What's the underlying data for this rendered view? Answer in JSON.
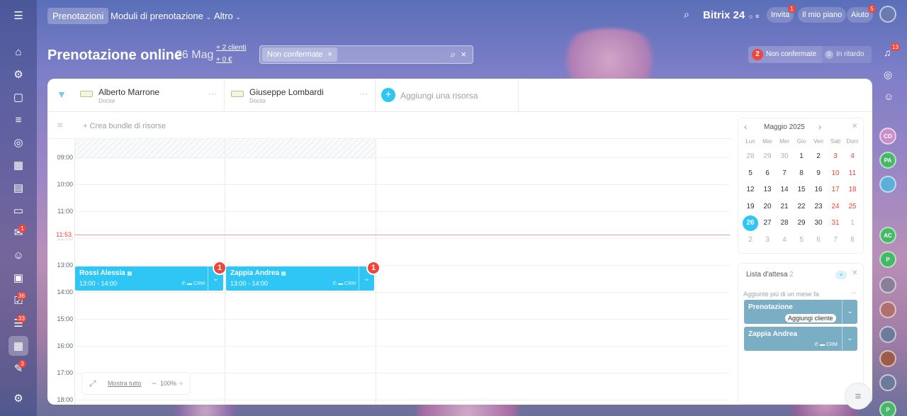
{
  "topbar": {
    "tabs": [
      "Prenotazioni",
      "Moduli di prenotazione",
      "Altro"
    ],
    "brand": "Bitrix 24",
    "buttons": {
      "invite": "Invita",
      "plan": "Il mio piano",
      "help": "Aiuto"
    },
    "badges": {
      "invite": "1",
      "help": "5"
    }
  },
  "header": {
    "title": "Prenotazione online",
    "date": "26 Mag",
    "clients": "+ 2 clienti",
    "money": "+ 0 €",
    "filter_chip": "Non confermate",
    "counter_unconfirmed_count": "2",
    "counter_unconfirmed_label": "Non confermate",
    "counter_late_count": "0",
    "counter_late_label": "In ritardo"
  },
  "resources": [
    {
      "name": "Alberto Marrone",
      "role": "Doctor"
    },
    {
      "name": "Giuseppe Lombardi",
      "role": "Doctor"
    }
  ],
  "add_resource": "Aggiungi una risorsa",
  "bundle": "+ Crea bundle di risorse",
  "hours": [
    "09:00",
    "10:00",
    "11:00",
    "12:00",
    "13:00",
    "14:00",
    "15:00",
    "16:00",
    "17:00",
    "18:00"
  ],
  "now": "11:53",
  "bookings": [
    {
      "name": "Rossi Alessia",
      "time": "13:00 - 14:00",
      "badge": "1"
    },
    {
      "name": "Zappia Andrea",
      "time": "13:00 - 14:00",
      "badge": "1"
    }
  ],
  "zoom": {
    "show_all": "Mostra tutto",
    "level": "100%"
  },
  "calendar": {
    "month": "Maggio 2025",
    "days": [
      "Lun",
      "Mar",
      "Mer",
      "Gio",
      "Ven",
      "Sab",
      "Dom"
    ],
    "weeks": [
      [
        "28",
        "29",
        "30",
        "1",
        "2",
        "3",
        "4"
      ],
      [
        "5",
        "6",
        "7",
        "8",
        "9",
        "10",
        "11"
      ],
      [
        "12",
        "13",
        "14",
        "15",
        "16",
        "17",
        "18"
      ],
      [
        "19",
        "20",
        "21",
        "22",
        "23",
        "24",
        "25"
      ],
      [
        "26",
        "27",
        "28",
        "29",
        "30",
        "31",
        "1"
      ],
      [
        "2",
        "3",
        "4",
        "5",
        "6",
        "7",
        "8"
      ]
    ],
    "selected": "26"
  },
  "waitlist": {
    "title": "Lista d'attesa",
    "count": "2",
    "note": "Aggiunte più di un mese fa",
    "items": [
      {
        "name": "Prenotazione",
        "action": "Aggiungi cliente"
      },
      {
        "name": "Zappia Andrea"
      }
    ]
  },
  "leftrail_badges": {
    "mail": "1",
    "tasks": "36",
    "feed": "33",
    "forms": "3"
  },
  "rightrail": {
    "notif_badge": "13",
    "avatars": [
      "CO",
      "PA",
      "AC",
      "P",
      "P"
    ]
  },
  "colors": {
    "accent": "#2fc6f6",
    "danger": "#f0453a",
    "now_line": "#f5a39a",
    "waitcard": "#7aaec5"
  }
}
